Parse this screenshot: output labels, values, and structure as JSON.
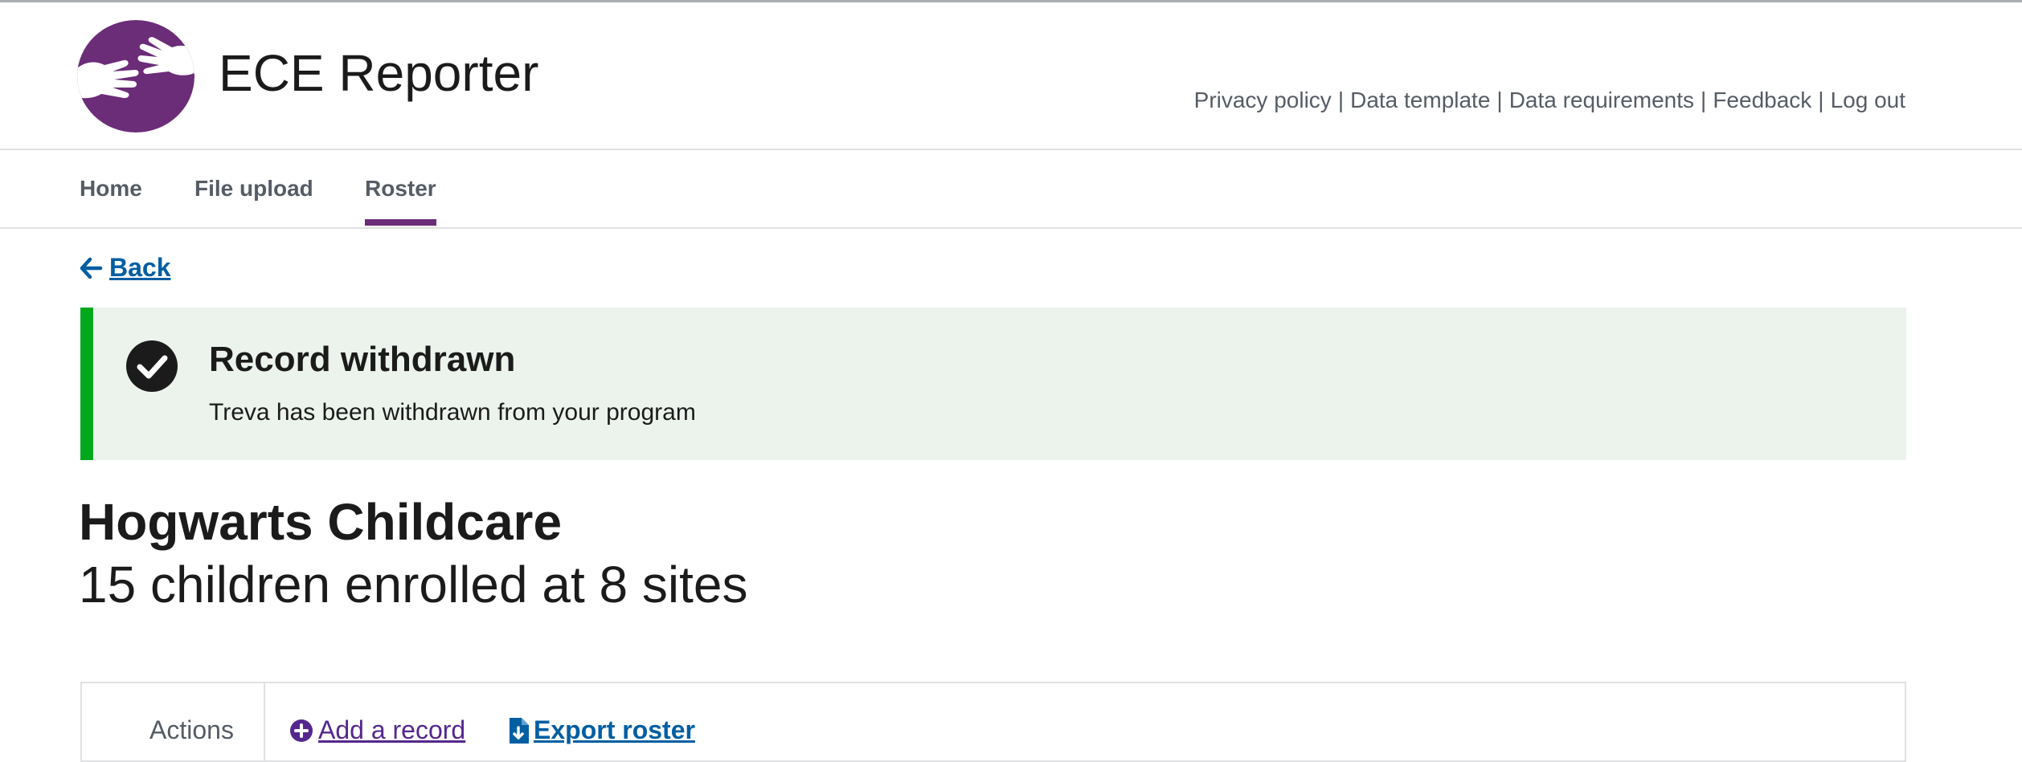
{
  "header": {
    "app_title": "ECE Reporter",
    "utility_links": [
      "Privacy policy",
      "Data template",
      "Data requirements",
      "Feedback",
      "Log out"
    ],
    "separator": "|"
  },
  "nav": {
    "items": [
      {
        "label": "Home"
      },
      {
        "label": "File upload"
      },
      {
        "label": "Roster"
      }
    ],
    "active": "Roster"
  },
  "back": {
    "label": "Back"
  },
  "alert": {
    "heading": "Record withdrawn",
    "body": "Treva has been withdrawn from your program"
  },
  "main": {
    "org_name": "Hogwarts Childcare",
    "summary": "15 children enrolled at 8 sites"
  },
  "actions": {
    "label": "Actions",
    "add_record": "Add a record",
    "export_roster": "Export roster"
  },
  "colors": {
    "brand_purple": "#6b2c78",
    "link_blue": "#005ea2",
    "success_green": "#00a91c",
    "alert_bg": "#ecf3ec"
  }
}
